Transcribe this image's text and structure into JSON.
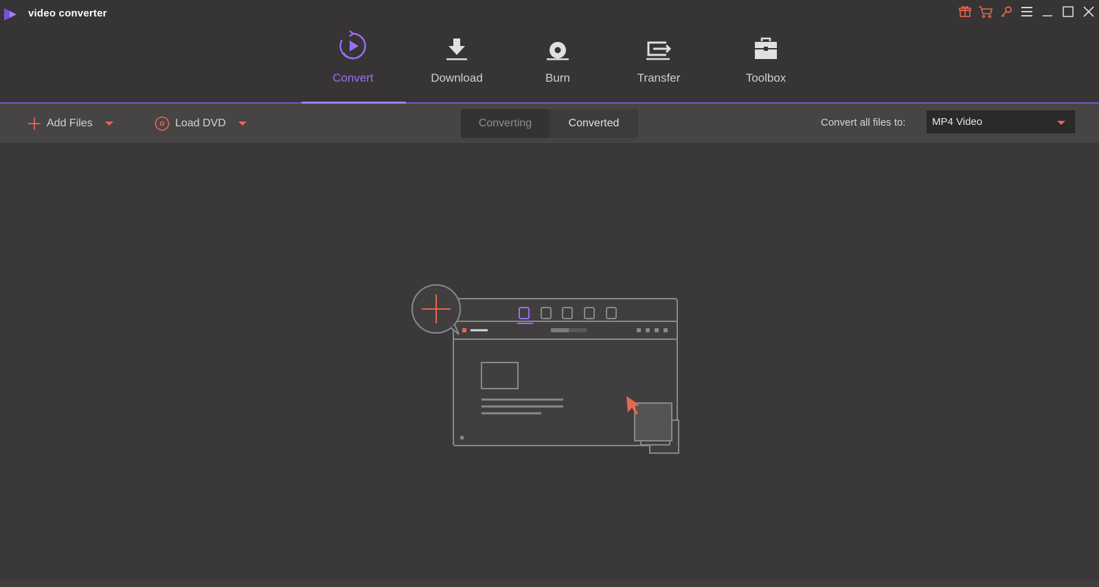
{
  "app": {
    "title": "video converter"
  },
  "window_controls": [
    "gift-icon",
    "cart-icon",
    "key-icon",
    "menu-icon",
    "minimize-icon",
    "maximize-icon",
    "close-icon"
  ],
  "nav": {
    "items": [
      {
        "label": "Convert",
        "icon": "convert-icon",
        "active": true
      },
      {
        "label": "Download",
        "icon": "download-icon",
        "active": false
      },
      {
        "label": "Burn",
        "icon": "burn-icon",
        "active": false
      },
      {
        "label": "Transfer",
        "icon": "transfer-icon",
        "active": false
      },
      {
        "label": "Toolbox",
        "icon": "toolbox-icon",
        "active": false
      }
    ]
  },
  "toolbar": {
    "add_files": "Add Files",
    "load_dvd": "Load DVD",
    "tabs": [
      {
        "label": "Converting",
        "selected": true
      },
      {
        "label": "Converted",
        "selected": false
      }
    ],
    "convert_all_label": "Convert all files to:",
    "format_value": "MP4 Video"
  },
  "colors": {
    "accent": "#9d6df0",
    "orange": "#e8674f",
    "background": "#3a3839",
    "toolbar": "#474445"
  }
}
